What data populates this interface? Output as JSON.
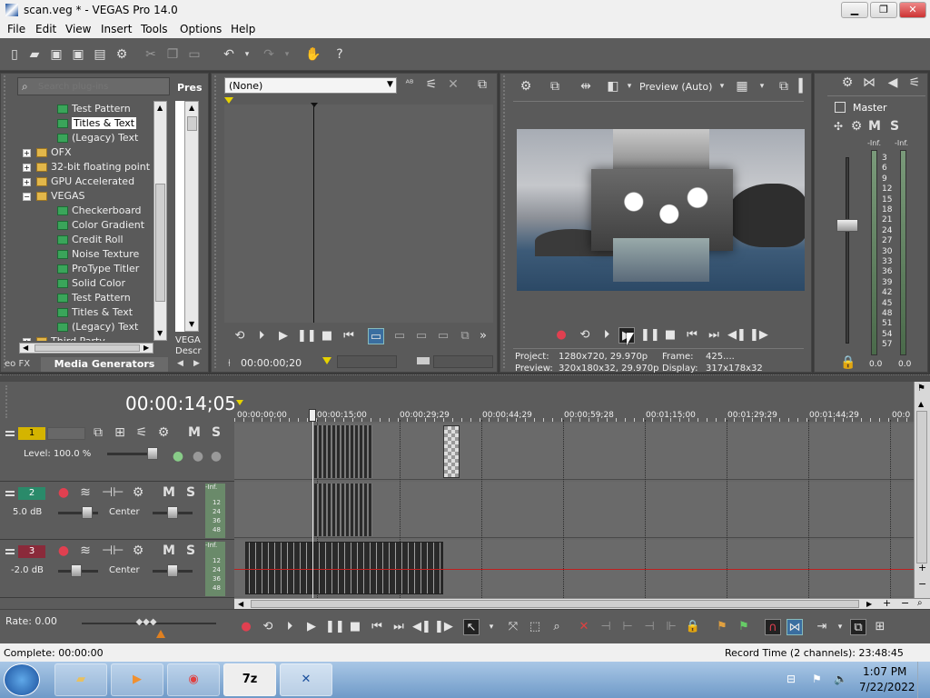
{
  "window": {
    "title": "scan.veg * - VEGAS Pro 14.0",
    "minimize_glyph": "▁",
    "maximize_glyph": "❐",
    "close_glyph": "✕"
  },
  "menu": [
    "File",
    "Edit",
    "View",
    "Insert",
    "Tools",
    "Options",
    "Help"
  ],
  "plugin_panel": {
    "search_placeholder": "Search plug-ins",
    "presets_label": "Pres",
    "tree": [
      {
        "label": "Test Pattern",
        "kind": "gen"
      },
      {
        "label": "Titles & Text",
        "kind": "gen",
        "selected": true
      },
      {
        "label": "(Legacy) Text",
        "kind": "gen"
      },
      {
        "label": "OFX",
        "kind": "folder"
      },
      {
        "label": "32-bit floating point",
        "kind": "folder"
      },
      {
        "label": "GPU Accelerated",
        "kind": "folder"
      },
      {
        "label": "VEGAS",
        "kind": "folder",
        "expanded": true
      },
      {
        "label": "Checkerboard",
        "kind": "gen"
      },
      {
        "label": "Color Gradient",
        "kind": "gen"
      },
      {
        "label": "Credit Roll",
        "kind": "gen"
      },
      {
        "label": "Noise Texture",
        "kind": "gen"
      },
      {
        "label": "ProType Titler",
        "kind": "gen"
      },
      {
        "label": "Solid Color",
        "kind": "gen"
      },
      {
        "label": "Test Pattern",
        "kind": "gen"
      },
      {
        "label": "Titles & Text",
        "kind": "gen"
      },
      {
        "label": "(Legacy) Text",
        "kind": "gen"
      },
      {
        "label": "Third Party",
        "kind": "folder"
      }
    ],
    "right_desc": [
      "VEGA",
      "Descr"
    ],
    "tabs": {
      "video_fx": "eo FX",
      "media_generators": "Media Generators"
    }
  },
  "trimmer": {
    "dropdown_value": "(None)",
    "timecode": "00:00:00;20"
  },
  "preview": {
    "mode_label": "Preview (Auto)",
    "project_label": "Project:",
    "project_value": "1280x720, 29.970p",
    "preview_label": "Preview:",
    "preview_value": "320x180x32, 29.970p",
    "frame_label": "Frame:",
    "frame_value": "425....",
    "display_label": "Display:",
    "display_value": "317x178x32"
  },
  "master": {
    "label": "Master",
    "inf_left": "-Inf.",
    "inf_right": "-Inf.",
    "scale": [
      "3",
      "6",
      "9",
      "12",
      "15",
      "18",
      "21",
      "24",
      "27",
      "30",
      "33",
      "36",
      "39",
      "42",
      "45",
      "48",
      "51",
      "54",
      "57"
    ],
    "bottom_left": "0.0",
    "bottom_right": "0.0"
  },
  "timeline": {
    "current_time": "00:00:14;05",
    "ruler": [
      "00:00:00;00",
      "00:00:15;00",
      "00:00:29;29",
      "00:00:44;29",
      "00:00:59;28",
      "00:01:15;00",
      "00:01:29;29",
      "00:01:44;29",
      "00:0"
    ],
    "tracks": [
      {
        "num": "1",
        "type": "video",
        "level_label": "Level: 100.0 %"
      },
      {
        "num": "2",
        "type": "audio",
        "vol": "5.0 dB",
        "pan": "Center",
        "meter": [
          "-Inf.",
          "12",
          "24",
          "36",
          "48"
        ]
      },
      {
        "num": "3",
        "type": "audio",
        "vol": "-2.0 dB",
        "pan": "Center",
        "meter": [
          "-Inf.",
          "12",
          "24",
          "36",
          "48"
        ]
      }
    ],
    "rate_label": "Rate: 0.00"
  },
  "status": {
    "left": "Complete: 00:00:00",
    "right": "Record Time (2 channels): 23:48:45"
  },
  "taskbar": {
    "time": "1:07 PM",
    "date": "7/22/2022",
    "apps": [
      "start",
      "explorer",
      "media-player",
      "chrome",
      "7zip",
      "vegas"
    ]
  },
  "colors": {
    "panel": "#5a5a5a",
    "track1": "#d4b400",
    "track2": "#2a8a6a",
    "track3": "#8a2a3a",
    "accent": "#4a9ad6"
  }
}
